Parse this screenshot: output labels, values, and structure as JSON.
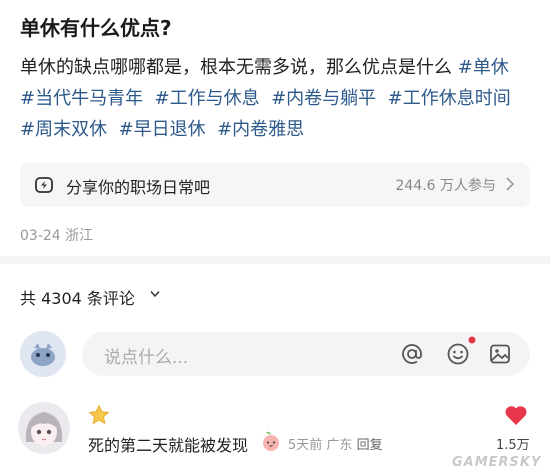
{
  "post": {
    "title": "单休有什么优点?",
    "body": "单休的缺点哪哪都是，根本无需多说，那么优点是什么",
    "tags": [
      "#单休",
      "#当代牛马青年",
      "#工作与休息",
      "#内卷与躺平",
      "#工作休息时间",
      "#周末双休",
      "#早日退休",
      "#内卷雅思"
    ],
    "date": "03-24",
    "location": "浙江"
  },
  "topic_card": {
    "label": "分享你的职场日常吧",
    "participants": "244.6 万人参与",
    "icon": "share-square-icon"
  },
  "comments": {
    "count_label": "共 4304 条评论",
    "input_placeholder": "说点什么...",
    "input_icons": [
      "at-icon",
      "emoji-icon",
      "image-icon"
    ],
    "items": [
      {
        "text": "死的第二天就能被发现",
        "time": "5天前",
        "location": "广东",
        "reply_label": "回复",
        "likes": "1.5万",
        "liked": true
      }
    ]
  },
  "colors": {
    "tag": "#2d5a8a",
    "like": "#e8364a",
    "accent_dot": "#e8364a"
  },
  "watermark": "GAMERSKY"
}
